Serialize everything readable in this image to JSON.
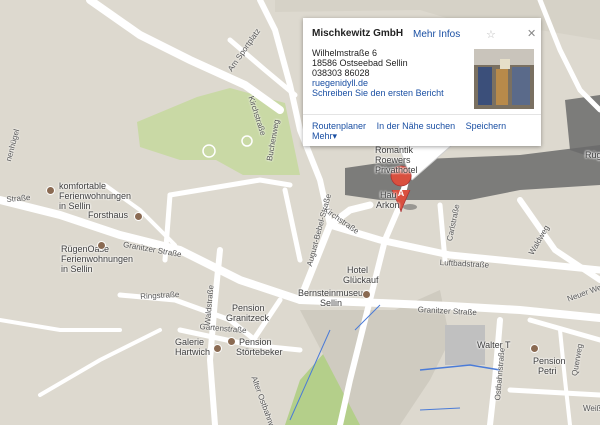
{
  "info": {
    "title": "Mischkewitz GmbH",
    "more_info": "Mehr Infos",
    "street": "Wilhelmstraße 6",
    "city": "18586 Ostseebad Sellin",
    "phone": "038303 86028",
    "website": "ruegenidyll.de",
    "review": "Schreiben Sie den ersten Bericht",
    "actions": [
      "Routenplaner",
      "In der Nähe suchen",
      "Speichern",
      "Mehr▾"
    ],
    "star_icon": "star-icon",
    "close_icon": "close-icon"
  },
  "marker": {
    "letter": "A",
    "color": "#d9503f"
  },
  "places": [
    "komfortable",
    "Ferienwohnungen",
    "in Sellin",
    "Forsthaus",
    "RügenOase",
    "Ferienwohnungen",
    "in Sellin",
    "Romantik",
    "Roewers",
    "Privathotel",
    "Hau",
    "Arkon",
    "Hotel",
    "Glückauf",
    "Bernsteinmuseum",
    "Sellin",
    "Pension",
    "Granitzeck",
    "Galerie",
    "Hartwich",
    "Pension",
    "Störtebeker",
    "Walter T",
    "Pension",
    "Petri",
    "Rüg"
  ],
  "streets": [
    "Am Sportplatz",
    "Kirchstraße",
    "Buchenweg",
    "August-Bebel-Straße",
    "Kirchstraße",
    "Carlstraße",
    "Luftbadstraße",
    "Waldweg",
    "Neuer Weg",
    "Granitzer Straße",
    "Ringstraße",
    "Granitzer Straße",
    "Gartenstraße",
    "Waldstraße",
    "Ostbahnstraße",
    "Querweg",
    "Weiß",
    "Straße",
    "nenhügel",
    "Alter Ostbahnwegl"
  ],
  "colors": {
    "land": "#ddd9cf",
    "road": "#ffffff",
    "park": "#c9d9a5",
    "green_strip": "#b4cf8a",
    "building": "#cfcbc0",
    "shadow": "#6b6b6b",
    "link": "#1a4fa3",
    "water_line": "#4a7bd8"
  }
}
